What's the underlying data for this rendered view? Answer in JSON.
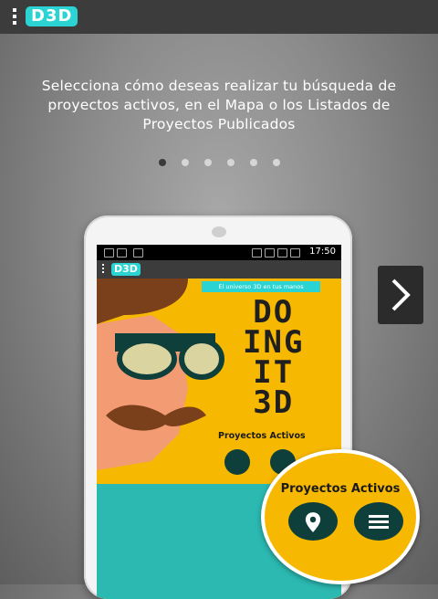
{
  "app": {
    "logo_text": "D3D"
  },
  "intro": {
    "text": "Selecciona cómo deseas realizar tu búsqueda de proyectos activos, en el Mapa o los Listados de Proyectos Publicados"
  },
  "pager": {
    "count": 6,
    "active_index": 0
  },
  "phone": {
    "status_time": "17:50",
    "logo_text": "D3D",
    "tagline": "El universo 3D en tus manos",
    "headline_lines": [
      "DO",
      "ING",
      "IT",
      "3D"
    ],
    "section_title": "Proyectos Activos"
  },
  "zoom": {
    "title": "Proyectos Activos",
    "map_icon": "map-pin-icon",
    "list_icon": "list-icon"
  },
  "colors": {
    "accent_cyan": "#2bd3d3",
    "yellow": "#f6b800",
    "dark_teal": "#0f3f3b"
  }
}
